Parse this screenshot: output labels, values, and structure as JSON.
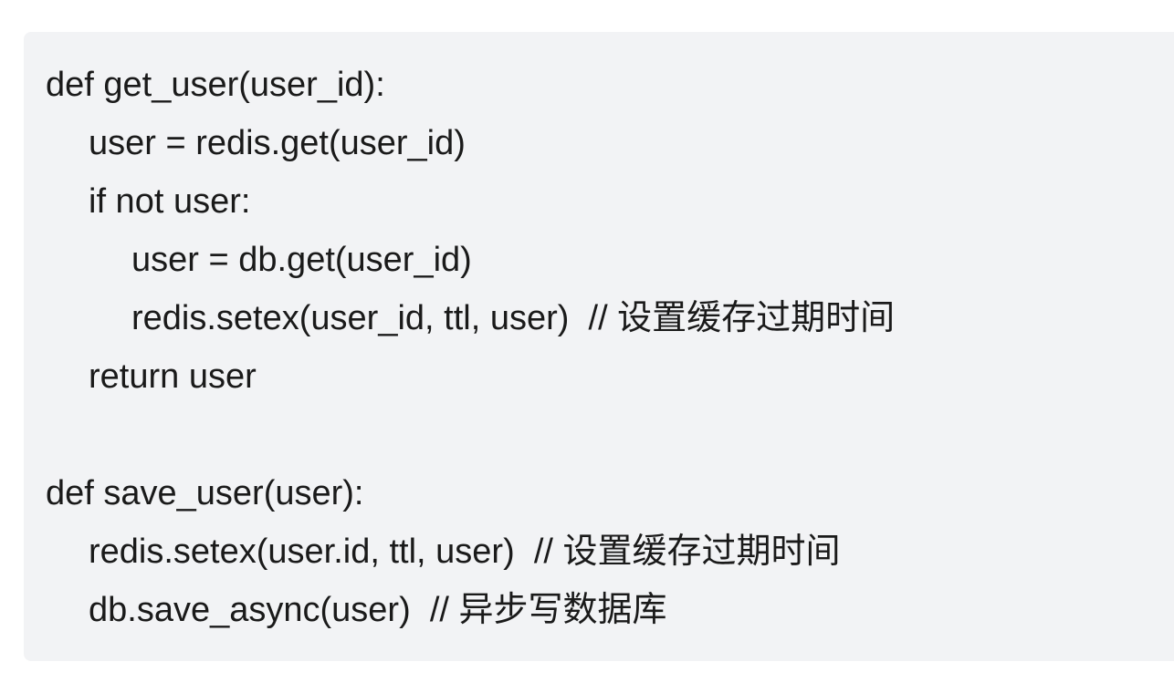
{
  "code": {
    "lines": [
      {
        "text": "def get_user(user_id):",
        "indent": 0
      },
      {
        "text": "user = redis.get(user_id)",
        "indent": 1
      },
      {
        "text": "if not user:",
        "indent": 1
      },
      {
        "text": "user = db.get(user_id)",
        "indent": 2
      },
      {
        "text": "redis.setex(user_id, ttl, user)  // 设置缓存过期时间",
        "indent": 2
      },
      {
        "text": "return user",
        "indent": 1
      },
      {
        "text": "",
        "indent": 0
      },
      {
        "text": "def save_user(user):",
        "indent": 0
      },
      {
        "text": "redis.setex(user.id, ttl, user)  // 设置缓存过期时间",
        "indent": 1
      },
      {
        "text": "db.save_async(user)  // 异步写数据库",
        "indent": 1
      }
    ]
  }
}
